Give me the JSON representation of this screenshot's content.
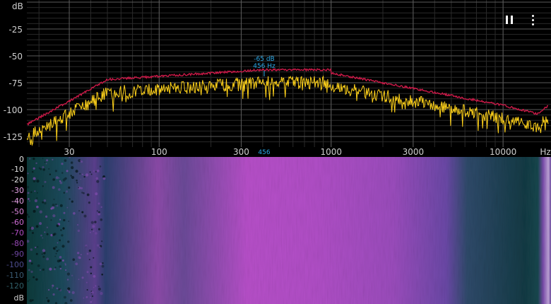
{
  "spectrum": {
    "y_unit": "dB",
    "x_unit": "Hz",
    "y_ticks": [
      "-25",
      "-50",
      "-75",
      "-100",
      "-125"
    ],
    "x_ticks": [
      "30",
      "100",
      "300",
      "1000",
      "3000",
      "10000"
    ],
    "cursor_value": "456",
    "peak_db_label": "-65 dB",
    "peak_hz_label": "456 Hz"
  },
  "spectrogram": {
    "scale_labels": [
      "0",
      "-10",
      "-20",
      "-30",
      "-40",
      "-50",
      "-60",
      "-70",
      "-80",
      "-90",
      "-100",
      "-110",
      "-120"
    ],
    "scale_unit": "dB"
  },
  "controls": {
    "pause_icon": "pause-icon",
    "menu_icon": "more-vert-icon"
  },
  "colors": {
    "background": "#000000",
    "live_trace": "#ffd21a",
    "peak_hold": "#d11a4a",
    "accent": "#2aa7e6",
    "spectrogram_high": "#b24fcc",
    "spectrogram_low": "#0c2a33"
  }
}
